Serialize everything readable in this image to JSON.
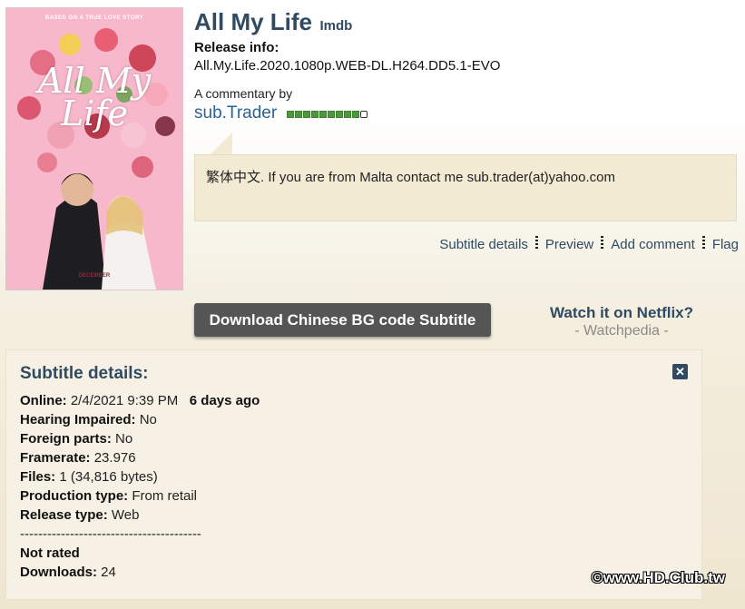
{
  "poster": {
    "tagline": "BASED ON A TRUE LOVE STORY",
    "title": "All My Life",
    "date": "DECEMBER"
  },
  "movie": {
    "title": "All My Life",
    "imdb_label": "Imdb"
  },
  "release": {
    "label": "Release info:",
    "value": "All.My.Life.2020.1080p.WEB-DL.H264.DD5.1-EVO"
  },
  "commentary": {
    "label": "A commentary by",
    "uploader": "sub.Trader",
    "rank_filled": 9,
    "rank_total": 10,
    "text": "繁体中文. If you are from Malta contact me sub.trader(at)yahoo.com"
  },
  "actions": {
    "details": "Subtitle details",
    "preview": "Preview",
    "add_comment": "Add comment",
    "flag": "Flag"
  },
  "download": {
    "label": "Download Chinese BG code Subtitle"
  },
  "netflix": {
    "title": "Watch it on Netflix?",
    "sub": "- Watchpedia -"
  },
  "details": {
    "title": "Subtitle details:",
    "close_icon": "close-x-icon",
    "online_label": "Online:",
    "online_value": "2/4/2021 9:39 PM",
    "online_ago": "6 days ago",
    "hi_label": "Hearing Impaired:",
    "hi_value": "No",
    "foreign_label": "Foreign parts:",
    "foreign_value": "No",
    "framerate_label": "Framerate:",
    "framerate_value": "23.976",
    "files_label": "Files:",
    "files_value": "1 (34,816 bytes)",
    "production_label": "Production type:",
    "production_value": "From retail",
    "release_type_label": "Release type:",
    "release_type_value": "Web",
    "separator": "----------------------------------------",
    "rating": "Not rated",
    "downloads_label": "Downloads:",
    "downloads_value": "24"
  },
  "watermark": "©www.HD.Club.tw",
  "colors": {
    "heading": "#2f4a61",
    "link": "#2a6394",
    "rank_green": "#4a9a3a",
    "comment_bg": "#f3ead3",
    "button": "#555555"
  }
}
